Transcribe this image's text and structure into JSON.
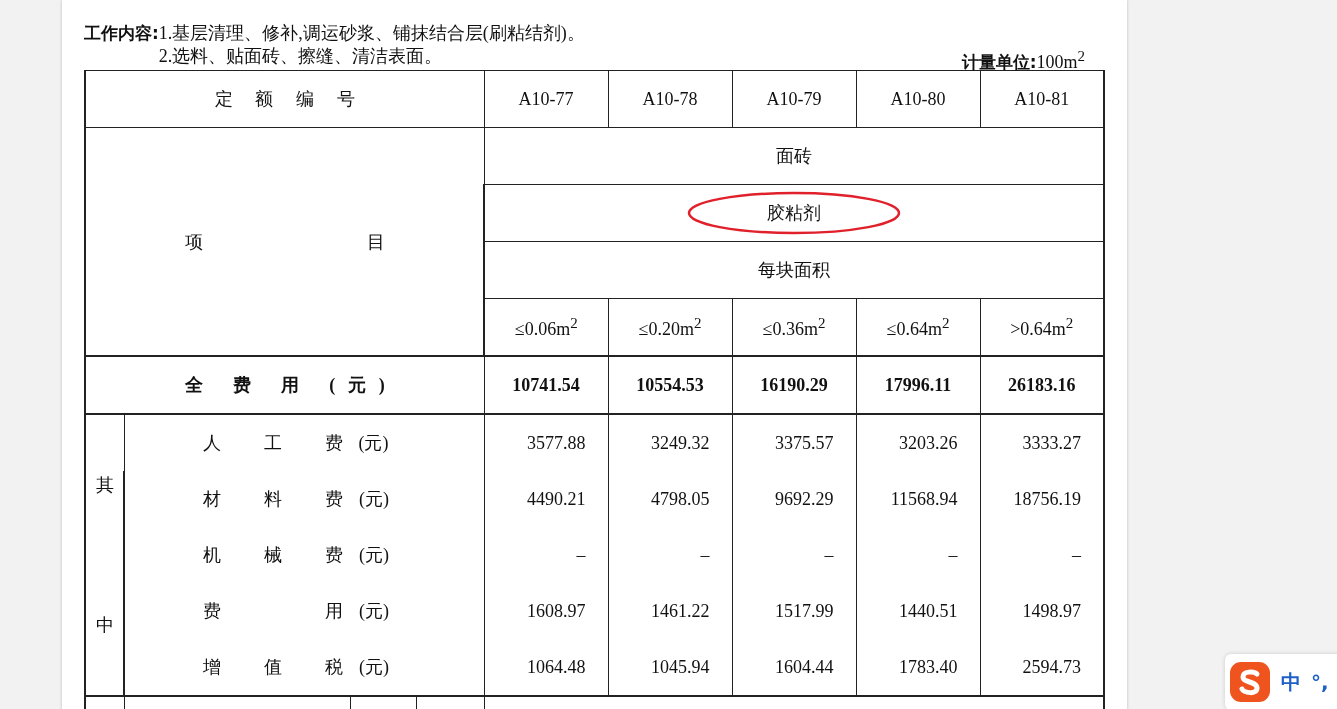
{
  "work_content": {
    "label": "工作内容:",
    "lines": [
      "1.基层清理、修补,调运砂浆、铺抹结合层(刷粘结剂)。",
      "2.选料、贴面砖、擦缝、清洁表面。"
    ]
  },
  "unit": {
    "label": "计量单位:",
    "value": "100m$^{2}$"
  },
  "table": {
    "code_header": "定 额 编 号",
    "codes": [
      "A10-77",
      "A10-78",
      "A10-79",
      "A10-80",
      "A10-81"
    ],
    "item_header": "项 目",
    "category": "面砖",
    "subcategory": "胶粘剂",
    "subcategory_circled": true,
    "size_header": "每块面积",
    "sizes": [
      "≤0.06m$^{2}$",
      "≤0.20m$^{2}$",
      "≤0.36m$^{2}$",
      "≤0.64m$^{2}$",
      ">0.64m$^{2}$"
    ],
    "total": {
      "label": "全 费 用 (元)",
      "values": [
        "10741.54",
        "10554.53",
        "16190.29",
        "17996.11",
        "26183.16"
      ]
    },
    "breakdown_label": "其中",
    "breakdown": [
      {
        "label": "人 工 费",
        "unit": "(元)",
        "values": [
          "3577.88",
          "3249.32",
          "3375.57",
          "3203.26",
          "3333.27"
        ]
      },
      {
        "label": "材 料 费",
        "unit": "(元)",
        "values": [
          "4490.21",
          "4798.05",
          "9692.29",
          "11568.94",
          "18756.19"
        ]
      },
      {
        "label": "机 械 费",
        "unit": "(元)",
        "values": [
          "–",
          "–",
          "–",
          "–",
          "–"
        ]
      },
      {
        "label": "费 用",
        "unit": "(元)",
        "values": [
          "1608.97",
          "1461.22",
          "1517.99",
          "1440.51",
          "1498.97"
        ]
      },
      {
        "label": "增 值 税",
        "unit": "(元)",
        "values": [
          "1064.48",
          "1045.94",
          "1604.44",
          "1783.40",
          "2594.73"
        ]
      }
    ]
  },
  "ime_toolbar": {
    "mode": "中",
    "punctuation": "°,"
  }
}
